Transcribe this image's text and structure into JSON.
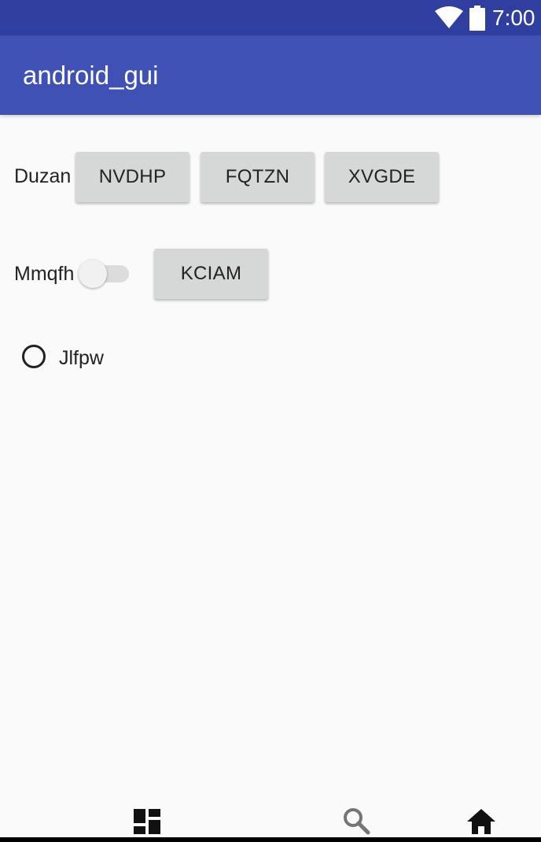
{
  "status_bar": {
    "time": "7:00",
    "icons": [
      "wifi-icon",
      "battery-icon"
    ]
  },
  "app_bar": {
    "title": "android_gui"
  },
  "row1": {
    "label": "Duzan",
    "buttons": [
      "NVDHP",
      "FQTZN",
      "XVGDE"
    ]
  },
  "row2": {
    "label": "Mmqfh",
    "switch_on": false,
    "button": "KCIAM"
  },
  "radio": {
    "label": "Jlfpw",
    "checked": false
  },
  "bottom_nav": {
    "icons": [
      "dashboard-icon",
      "search-icon",
      "home-icon"
    ]
  },
  "colors": {
    "status_bar": "#303f9f",
    "app_bar": "#3f51b5",
    "background": "#fafafa",
    "button": "#d6d7d7"
  }
}
